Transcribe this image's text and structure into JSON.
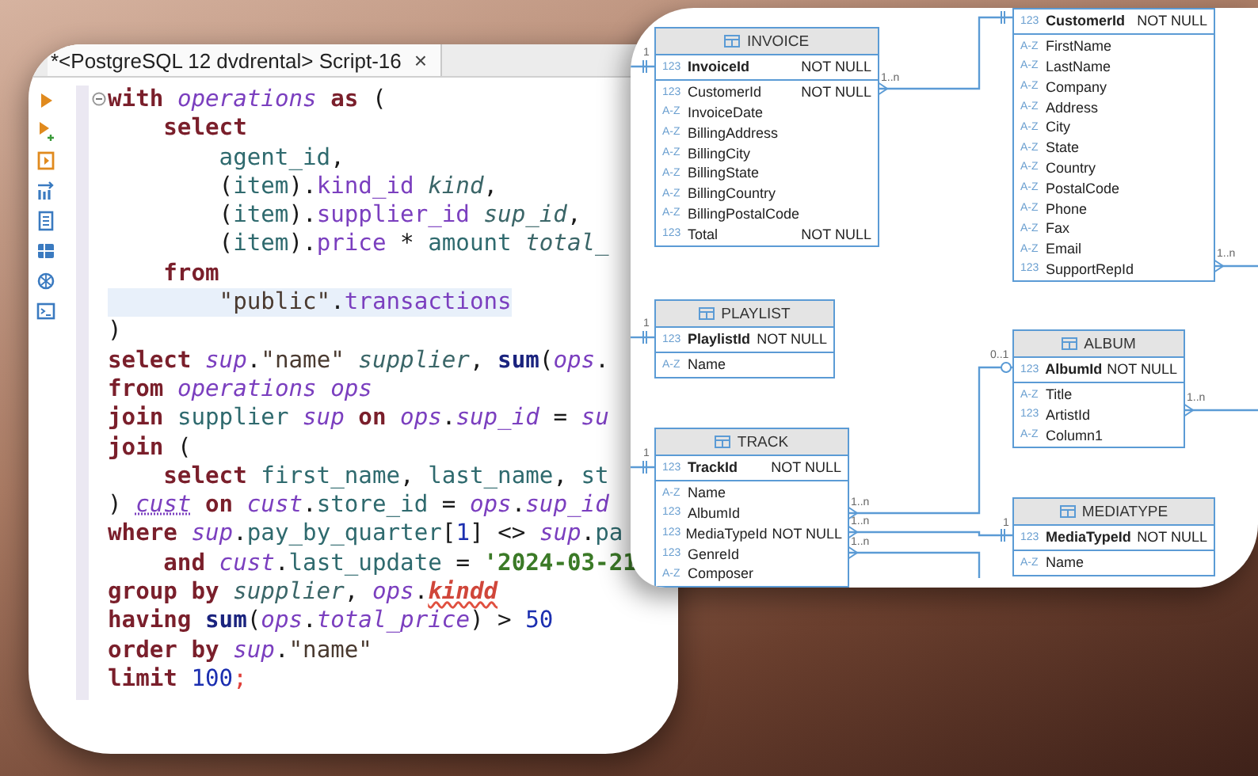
{
  "editor": {
    "tab": {
      "title": "*<PostgreSQL 12 dvdrental> Script-16",
      "close": "×"
    },
    "lines": [
      {
        "current": false,
        "tokens": [
          {
            "kind": "kw",
            "text": "with"
          },
          {
            "kind": "var",
            "text": " operations"
          },
          {
            "kind": "kw",
            "text": " as"
          },
          {
            "kind": "p",
            "text": " ("
          }
        ]
      },
      {
        "current": false,
        "tokens": [
          {
            "kind": "kw",
            "text": "    select"
          }
        ]
      },
      {
        "current": false,
        "tokens": [
          {
            "kind": "col",
            "text": "        agent_id"
          },
          {
            "kind": "p",
            "text": ","
          }
        ]
      },
      {
        "current": false,
        "tokens": [
          {
            "kind": "p",
            "text": "        ("
          },
          {
            "kind": "col",
            "text": "item"
          },
          {
            "kind": "p",
            "text": ")."
          },
          {
            "kind": "tbl",
            "text": "kind_id"
          },
          {
            "kind": "alias",
            "text": " kind"
          },
          {
            "kind": "p",
            "text": ","
          }
        ]
      },
      {
        "current": false,
        "tokens": [
          {
            "kind": "p",
            "text": "        ("
          },
          {
            "kind": "col",
            "text": "item"
          },
          {
            "kind": "p",
            "text": ")."
          },
          {
            "kind": "tbl",
            "text": "supplier_id"
          },
          {
            "kind": "alias",
            "text": " sup_id"
          },
          {
            "kind": "p",
            "text": ","
          }
        ]
      },
      {
        "current": false,
        "tokens": [
          {
            "kind": "p",
            "text": "        ("
          },
          {
            "kind": "col",
            "text": "item"
          },
          {
            "kind": "p",
            "text": ")."
          },
          {
            "kind": "tbl",
            "text": "price"
          },
          {
            "kind": "p",
            "text": " * "
          },
          {
            "kind": "col",
            "text": "amount"
          },
          {
            "kind": "alias",
            "text": " total_"
          }
        ]
      },
      {
        "current": false,
        "tokens": [
          {
            "kind": "kw",
            "text": "    from"
          }
        ]
      },
      {
        "current": true,
        "tokens": [
          {
            "kind": "str",
            "text": "        \"public\""
          },
          {
            "kind": "p",
            "text": "."
          },
          {
            "kind": "tbl",
            "text": "transactions"
          }
        ]
      },
      {
        "current": false,
        "tokens": [
          {
            "kind": "p",
            "text": ")"
          }
        ]
      },
      {
        "current": false,
        "tokens": [
          {
            "kind": "kw",
            "text": "select"
          },
          {
            "kind": "var",
            "text": " sup"
          },
          {
            "kind": "p",
            "text": "."
          },
          {
            "kind": "str",
            "text": "\"name\""
          },
          {
            "kind": "alias",
            "text": " supplier"
          },
          {
            "kind": "p",
            "text": ", "
          },
          {
            "kind": "fn",
            "text": "sum"
          },
          {
            "kind": "p",
            "text": "("
          },
          {
            "kind": "var",
            "text": "ops"
          },
          {
            "kind": "p",
            "text": "."
          }
        ]
      },
      {
        "current": false,
        "tokens": [
          {
            "kind": "kw",
            "text": "from"
          },
          {
            "kind": "var",
            "text": " operations"
          },
          {
            "kind": "var",
            "text": " ops"
          }
        ]
      },
      {
        "current": false,
        "tokens": [
          {
            "kind": "kw",
            "text": "join"
          },
          {
            "kind": "col",
            "text": " supplier"
          },
          {
            "kind": "var",
            "text": " sup"
          },
          {
            "kind": "kw",
            "text": " on"
          },
          {
            "kind": "var",
            "text": " ops"
          },
          {
            "kind": "p",
            "text": "."
          },
          {
            "kind": "var",
            "text": "sup_id"
          },
          {
            "kind": "p",
            "text": " = "
          },
          {
            "kind": "var",
            "text": "su"
          }
        ]
      },
      {
        "current": false,
        "tokens": [
          {
            "kind": "kw",
            "text": "join"
          },
          {
            "kind": "p",
            "text": " ("
          }
        ]
      },
      {
        "current": false,
        "tokens": [
          {
            "kind": "kw",
            "text": "    select"
          },
          {
            "kind": "col",
            "text": " first_name"
          },
          {
            "kind": "p",
            "text": ", "
          },
          {
            "kind": "col",
            "text": "last_name"
          },
          {
            "kind": "p",
            "text": ", "
          },
          {
            "kind": "col",
            "text": "st"
          }
        ]
      },
      {
        "current": false,
        "tokens": [
          {
            "kind": "p",
            "text": ") "
          },
          {
            "kind": "warn",
            "text": "cust"
          },
          {
            "kind": "kw",
            "text": " on"
          },
          {
            "kind": "var",
            "text": " cust"
          },
          {
            "kind": "p",
            "text": "."
          },
          {
            "kind": "col",
            "text": "store_id"
          },
          {
            "kind": "p",
            "text": " = "
          },
          {
            "kind": "var",
            "text": "ops"
          },
          {
            "kind": "p",
            "text": "."
          },
          {
            "kind": "var",
            "text": "sup_id"
          }
        ]
      },
      {
        "current": false,
        "tokens": [
          {
            "kind": "kw",
            "text": "where"
          },
          {
            "kind": "var",
            "text": " sup"
          },
          {
            "kind": "p",
            "text": "."
          },
          {
            "kind": "col",
            "text": "pay_by_quarter"
          },
          {
            "kind": "p",
            "text": "["
          },
          {
            "kind": "num",
            "text": "1"
          },
          {
            "kind": "p",
            "text": "] <> "
          },
          {
            "kind": "var",
            "text": "sup"
          },
          {
            "kind": "p",
            "text": "."
          },
          {
            "kind": "col",
            "text": "pa"
          }
        ]
      },
      {
        "current": false,
        "tokens": [
          {
            "kind": "kw",
            "text": "    and"
          },
          {
            "kind": "var",
            "text": " cust"
          },
          {
            "kind": "p",
            "text": "."
          },
          {
            "kind": "col",
            "text": "last_update"
          },
          {
            "kind": "p",
            "text": " = "
          },
          {
            "kind": "date",
            "text": "'2024-03-21"
          }
        ]
      },
      {
        "current": false,
        "tokens": [
          {
            "kind": "kw",
            "text": "group by"
          },
          {
            "kind": "alias",
            "text": " supplier"
          },
          {
            "kind": "p",
            "text": ", "
          },
          {
            "kind": "var",
            "text": "ops"
          },
          {
            "kind": "p",
            "text": "."
          },
          {
            "kind": "err",
            "text": "kindd"
          }
        ]
      },
      {
        "current": false,
        "tokens": [
          {
            "kind": "kw",
            "text": "having"
          },
          {
            "kind": "fn",
            "text": " sum"
          },
          {
            "kind": "p",
            "text": "("
          },
          {
            "kind": "var",
            "text": "ops"
          },
          {
            "kind": "p",
            "text": "."
          },
          {
            "kind": "var",
            "text": "total_price"
          },
          {
            "kind": "p",
            "text": ") > "
          },
          {
            "kind": "num",
            "text": "50"
          }
        ]
      },
      {
        "current": false,
        "tokens": [
          {
            "kind": "kw",
            "text": "order by"
          },
          {
            "kind": "var",
            "text": " sup"
          },
          {
            "kind": "p",
            "text": "."
          },
          {
            "kind": "str",
            "text": "\"name\""
          }
        ]
      },
      {
        "current": false,
        "tokens": [
          {
            "kind": "kw",
            "text": "limit"
          },
          {
            "kind": "num",
            "text": " 100"
          },
          {
            "kind": "semi",
            "text": ";"
          }
        ]
      }
    ]
  },
  "diagram": {
    "tables": [
      {
        "name": "INVOICE",
        "keys": [
          {
            "type": "123",
            "name": "InvoiceId",
            "constraint": "NOT NULL"
          }
        ],
        "columns": [
          {
            "type": "123",
            "name": "CustomerId",
            "constraint": "NOT NULL"
          },
          {
            "type": "A-Z",
            "name": "InvoiceDate"
          },
          {
            "type": "A-Z",
            "name": "BillingAddress"
          },
          {
            "type": "A-Z",
            "name": "BillingCity"
          },
          {
            "type": "A-Z",
            "name": "BillingState"
          },
          {
            "type": "A-Z",
            "name": "BillingCountry"
          },
          {
            "type": "A-Z",
            "name": "BillingPostalCode"
          },
          {
            "type": "123",
            "name": "Total",
            "constraint": "NOT NULL"
          }
        ]
      },
      {
        "keys": [
          {
            "type": "123",
            "name": "CustomerId",
            "constraint": "NOT NULL"
          }
        ],
        "columns": [
          {
            "type": "A-Z",
            "name": "FirstName"
          },
          {
            "type": "A-Z",
            "name": "LastName"
          },
          {
            "type": "A-Z",
            "name": "Company"
          },
          {
            "type": "A-Z",
            "name": "Address"
          },
          {
            "type": "A-Z",
            "name": "City"
          },
          {
            "type": "A-Z",
            "name": "State"
          },
          {
            "type": "A-Z",
            "name": "Country"
          },
          {
            "type": "A-Z",
            "name": "PostalCode"
          },
          {
            "type": "A-Z",
            "name": "Phone"
          },
          {
            "type": "A-Z",
            "name": "Fax"
          },
          {
            "type": "A-Z",
            "name": "Email"
          },
          {
            "type": "123",
            "name": "SupportRepId"
          }
        ]
      },
      {
        "name": "PLAYLIST",
        "keys": [
          {
            "type": "123",
            "name": "PlaylistId",
            "constraint": "NOT NULL"
          }
        ],
        "columns": [
          {
            "type": "A-Z",
            "name": "Name"
          }
        ]
      },
      {
        "name": "ALBUM",
        "keys": [
          {
            "type": "123",
            "name": "AlbumId",
            "constraint": "NOT NULL"
          }
        ],
        "columns": [
          {
            "type": "A-Z",
            "name": "Title"
          },
          {
            "type": "123",
            "name": "ArtistId"
          },
          {
            "type": "A-Z",
            "name": "Column1"
          }
        ]
      },
      {
        "name": "TRACK",
        "keys": [
          {
            "type": "123",
            "name": "TrackId",
            "constraint": "NOT NULL"
          }
        ],
        "columns": [
          {
            "type": "A-Z",
            "name": "Name"
          },
          {
            "type": "123",
            "name": "AlbumId"
          },
          {
            "type": "123",
            "name": "MediaTypeId",
            "constraint": "NOT NULL"
          },
          {
            "type": "123",
            "name": "GenreId"
          },
          {
            "type": "A-Z",
            "name": "Composer"
          }
        ]
      },
      {
        "name": "MEDIATYPE",
        "keys": [
          {
            "type": "123",
            "name": "MediaTypeId",
            "constraint": "NOT NULL"
          }
        ],
        "columns": [
          {
            "type": "A-Z",
            "name": "Name"
          }
        ]
      }
    ],
    "connectors": [
      {
        "labels": [
          "1"
        ]
      },
      {
        "labels": [
          "1..n"
        ]
      },
      {
        "labels": [
          "1..n"
        ]
      },
      {
        "labels": [
          "1"
        ]
      },
      {
        "labels": [
          "1"
        ]
      },
      {
        "labels": [
          "1..n",
          "0..1"
        ]
      },
      {
        "labels": [
          "1..n",
          "1"
        ]
      },
      {
        "labels": [
          "1..n"
        ]
      },
      {
        "labels": [
          "1..n"
        ]
      }
    ]
  }
}
